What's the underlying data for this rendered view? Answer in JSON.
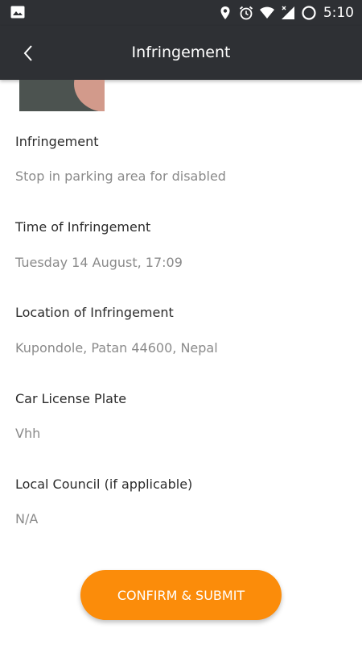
{
  "status_bar": {
    "time": "5:10",
    "icons": [
      "image-icon",
      "location-icon",
      "alarm-icon",
      "wifi-icon",
      "signal-icon",
      "battery-icon"
    ]
  },
  "app_bar": {
    "title": "Infringement",
    "back_icon": "chevron-left-icon"
  },
  "fields": [
    {
      "label": "Infringement",
      "value": "Stop in parking area for disabled"
    },
    {
      "label": "Time of Infringement",
      "value": "Tuesday 14 August, 17:09"
    },
    {
      "label": "Location of Infringement",
      "value": "Kupondole, Patan 44600, Nepal"
    },
    {
      "label": "Car License Plate",
      "value": "Vhh"
    },
    {
      "label": "Local Council (if applicable)",
      "value": "N/A"
    }
  ],
  "submit_button": {
    "label": "CONFIRM & SUBMIT",
    "color": "#fb8c0a"
  },
  "colors": {
    "bar": "#2e3034",
    "accent": "#fb8c0a"
  }
}
